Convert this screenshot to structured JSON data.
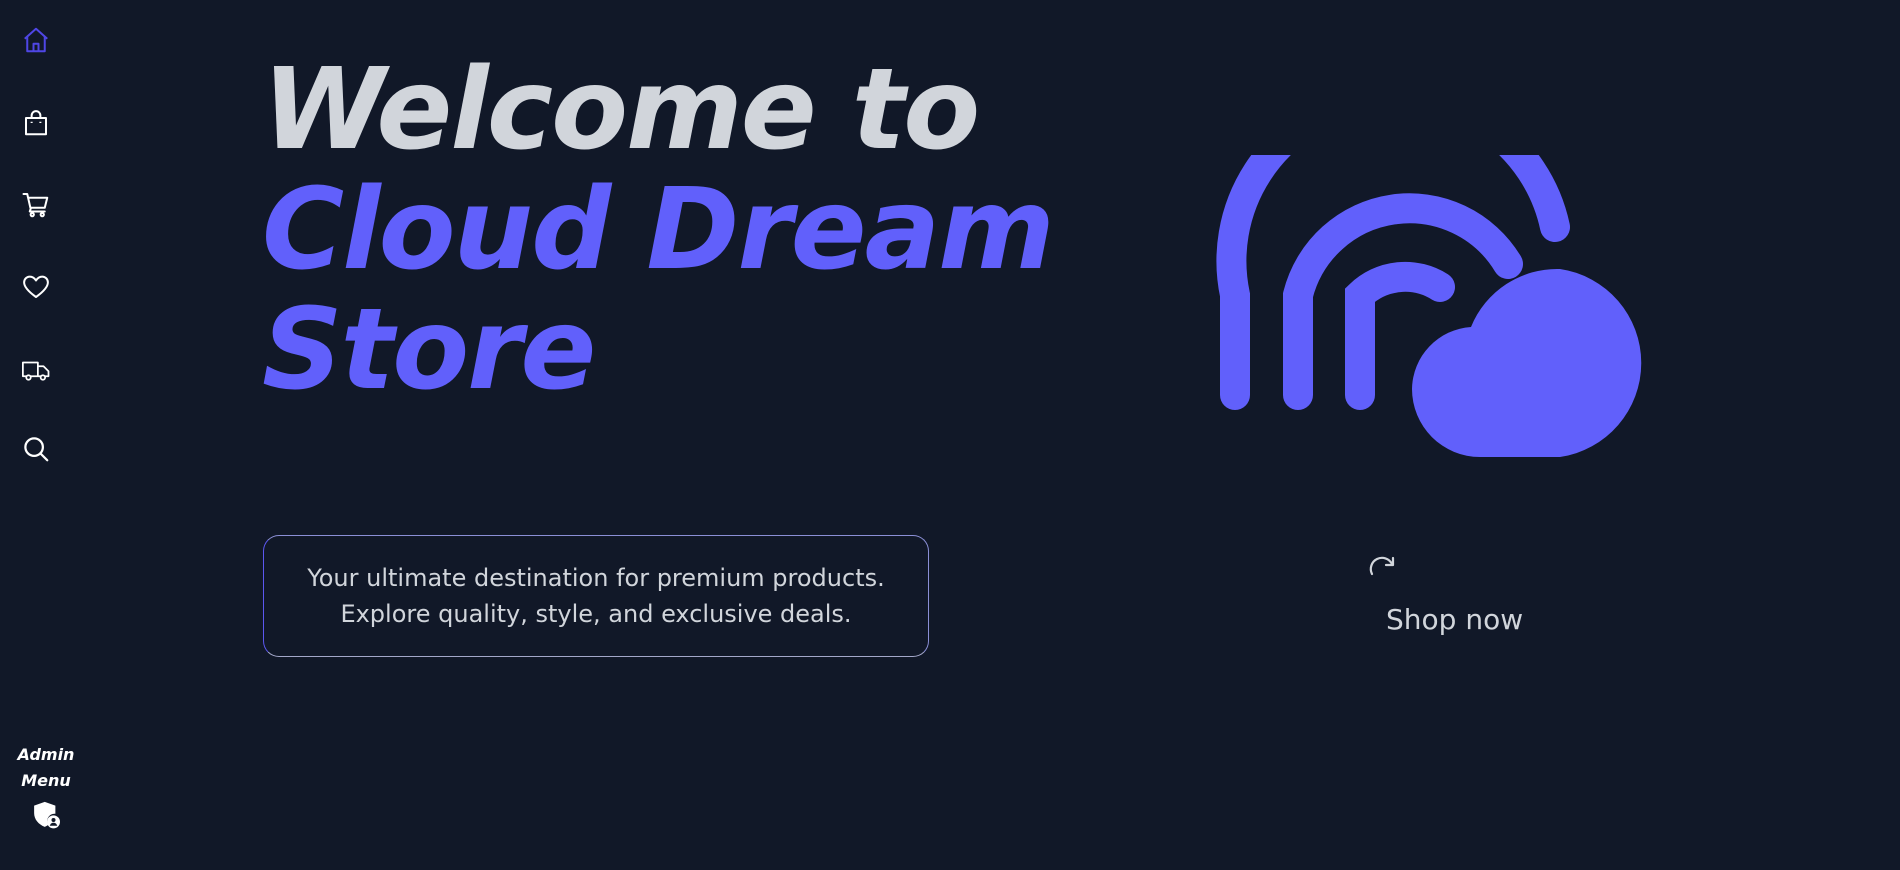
{
  "sidebar": {
    "items": [
      {
        "name": "home",
        "icon": "home-icon",
        "active": true
      },
      {
        "name": "shop",
        "icon": "shopping-bag-icon"
      },
      {
        "name": "cart",
        "icon": "cart-icon"
      },
      {
        "name": "wishlist",
        "icon": "heart-icon"
      },
      {
        "name": "delivery",
        "icon": "truck-icon"
      },
      {
        "name": "search",
        "icon": "search-icon"
      }
    ],
    "admin_label_line1": "Admin",
    "admin_label_line2": "Menu",
    "admin_icon": "shield-user-icon"
  },
  "hero": {
    "title_line1": "Welcome to",
    "title_line2": "Cloud Dream",
    "title_line3": "Store",
    "tagline_line1": "Your ultimate destination for premium products.",
    "tagline_line2": "Explore quality, style, and exclusive deals.",
    "illustration_icon": "cloud-rainbow-icon",
    "cta_icon": "redo-arrow-icon",
    "cta_label": "Shop now"
  },
  "colors": {
    "background": "#111828",
    "accent": "#6160fb",
    "text_light": "#d1d5db",
    "active_nav": "#4f46e5",
    "icon_default": "#ffffff"
  }
}
